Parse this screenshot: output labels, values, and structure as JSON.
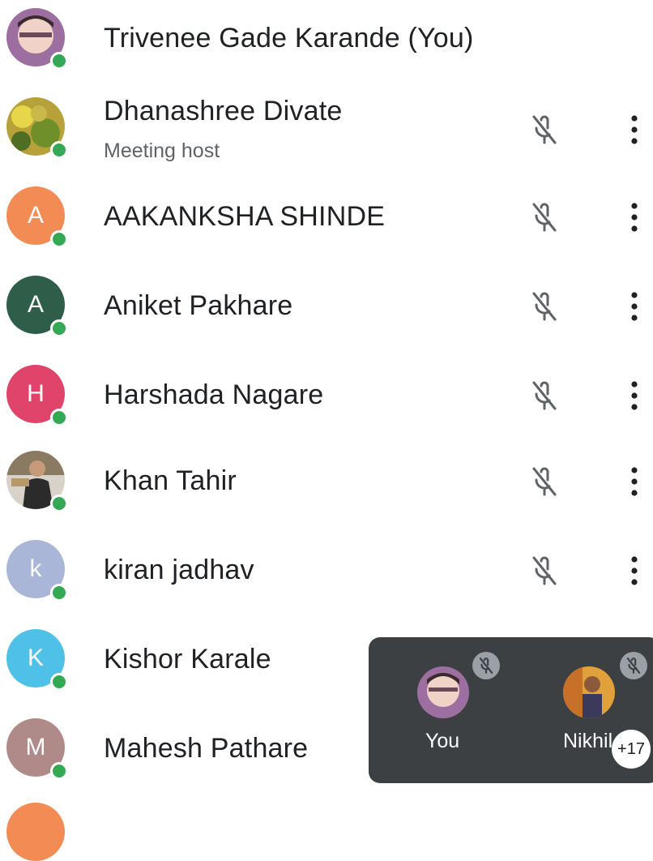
{
  "participants": [
    {
      "name": "Trivenee Gade Karande (You)",
      "initial": "",
      "avatar_color": "#b48ab5",
      "online": true
    },
    {
      "name": "Dhanashree Divate",
      "subtitle": "Meeting host",
      "initial": "",
      "avatar_color": "#8aa83a",
      "online": true,
      "mic_icon": "mic-off-icon"
    },
    {
      "name": "AAKANKSHA SHINDE",
      "initial": "A",
      "avatar_color": "#f28b54",
      "online": true,
      "mic_icon": "mic-off-icon"
    },
    {
      "name": "Aniket Pakhare",
      "initial": "A",
      "avatar_color": "#2e5e4a",
      "online": true,
      "mic_icon": "mic-off-icon"
    },
    {
      "name": "Harshada Nagare",
      "initial": "H",
      "avatar_color": "#e0446a",
      "online": true,
      "mic_icon": "mic-off-icon"
    },
    {
      "name": "Khan Tahir",
      "initial": "",
      "avatar_color": "#6b5a4a",
      "online": true,
      "mic_icon": "mic-off-icon"
    },
    {
      "name": "kiran jadhav",
      "initial": "k",
      "avatar_color": "#a9b6d8",
      "online": true,
      "mic_icon": "mic-off-icon"
    },
    {
      "name": "Kishor Karale",
      "initial": "K",
      "avatar_color": "#4fc0e8",
      "online": true
    },
    {
      "name": "Mahesh Pathare",
      "initial": "M",
      "avatar_color": "#b08a88",
      "online": true
    }
  ],
  "mini_view": {
    "tiles": [
      {
        "label": "You",
        "mic_icon": "mic-off-icon"
      },
      {
        "label": "Nikhil",
        "mic_icon": "mic-off-icon"
      }
    ],
    "more_count": "+17"
  },
  "colors": {
    "online_dot": "#34a853",
    "muted_icon": "#5f6368",
    "mini_bg": "#3c4043"
  }
}
